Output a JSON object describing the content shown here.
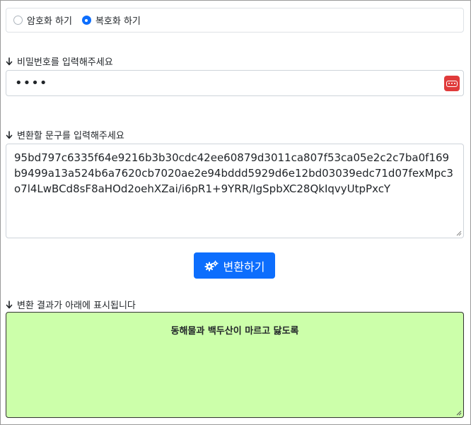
{
  "mode": {
    "options": [
      {
        "label": "암호화 하기",
        "checked": false
      },
      {
        "label": "복호화 하기",
        "checked": true
      }
    ]
  },
  "password": {
    "label": "비밀번호를 입력해주세요",
    "masked_value": "••••",
    "manager_icon": "password-manager-icon"
  },
  "input_text": {
    "label": "변환할 문구를 입력해주세요",
    "value": "95bd797c6335f64e9216b3b30cdc42ee60879d3011ca807f53ca05e2c2c7ba0f169b9499a13a524b6a7620cb7020ae2e94bddd5929d6e12bd03039edc71d07fexMpc3o7l4LwBCd8sF8aHOd2oehXZai/i6pR1+9YRR/IgSpbXC28QkIqvyUtpPxcY"
  },
  "convert_button": {
    "label": "변환하기",
    "icon": "gears-icon"
  },
  "result": {
    "label": "변환 결과가 아래에 표시됩니다",
    "value": "동해물과 백두산이 마르고 닳도록"
  },
  "colors": {
    "primary": "#0d6efd",
    "result_bg": "#ccffaa",
    "pw_manager": "#e03b3b"
  }
}
